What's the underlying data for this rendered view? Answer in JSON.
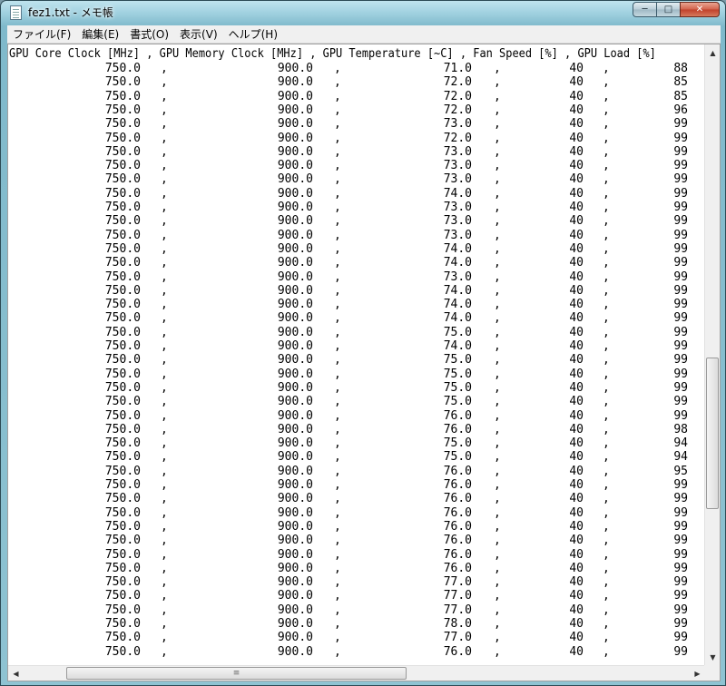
{
  "window": {
    "title": "fez1.txt - メモ帳"
  },
  "caption": {
    "minimize": "─",
    "maximize": "□",
    "close": "✕"
  },
  "menu": [
    "ファイル(F)",
    "編集(E)",
    "書式(O)",
    "表示(V)",
    "ヘルプ(H)"
  ],
  "header": "GPU Core Clock [MHz] , GPU Memory Clock [MHz] , GPU Temperature [~C] , Fan Speed [%] , GPU Load [%]",
  "rows": [
    [
      "750.0",
      "900.0",
      "71.0",
      "40",
      "88"
    ],
    [
      "750.0",
      "900.0",
      "72.0",
      "40",
      "85"
    ],
    [
      "750.0",
      "900.0",
      "72.0",
      "40",
      "85"
    ],
    [
      "750.0",
      "900.0",
      "72.0",
      "40",
      "96"
    ],
    [
      "750.0",
      "900.0",
      "73.0",
      "40",
      "99"
    ],
    [
      "750.0",
      "900.0",
      "72.0",
      "40",
      "99"
    ],
    [
      "750.0",
      "900.0",
      "73.0",
      "40",
      "99"
    ],
    [
      "750.0",
      "900.0",
      "73.0",
      "40",
      "99"
    ],
    [
      "750.0",
      "900.0",
      "73.0",
      "40",
      "99"
    ],
    [
      "750.0",
      "900.0",
      "74.0",
      "40",
      "99"
    ],
    [
      "750.0",
      "900.0",
      "73.0",
      "40",
      "99"
    ],
    [
      "750.0",
      "900.0",
      "73.0",
      "40",
      "99"
    ],
    [
      "750.0",
      "900.0",
      "73.0",
      "40",
      "99"
    ],
    [
      "750.0",
      "900.0",
      "74.0",
      "40",
      "99"
    ],
    [
      "750.0",
      "900.0",
      "74.0",
      "40",
      "99"
    ],
    [
      "750.0",
      "900.0",
      "73.0",
      "40",
      "99"
    ],
    [
      "750.0",
      "900.0",
      "74.0",
      "40",
      "99"
    ],
    [
      "750.0",
      "900.0",
      "74.0",
      "40",
      "99"
    ],
    [
      "750.0",
      "900.0",
      "74.0",
      "40",
      "99"
    ],
    [
      "750.0",
      "900.0",
      "75.0",
      "40",
      "99"
    ],
    [
      "750.0",
      "900.0",
      "74.0",
      "40",
      "99"
    ],
    [
      "750.0",
      "900.0",
      "75.0",
      "40",
      "99"
    ],
    [
      "750.0",
      "900.0",
      "75.0",
      "40",
      "99"
    ],
    [
      "750.0",
      "900.0",
      "75.0",
      "40",
      "99"
    ],
    [
      "750.0",
      "900.0",
      "75.0",
      "40",
      "99"
    ],
    [
      "750.0",
      "900.0",
      "76.0",
      "40",
      "99"
    ],
    [
      "750.0",
      "900.0",
      "76.0",
      "40",
      "98"
    ],
    [
      "750.0",
      "900.0",
      "75.0",
      "40",
      "94"
    ],
    [
      "750.0",
      "900.0",
      "75.0",
      "40",
      "94"
    ],
    [
      "750.0",
      "900.0",
      "76.0",
      "40",
      "95"
    ],
    [
      "750.0",
      "900.0",
      "76.0",
      "40",
      "99"
    ],
    [
      "750.0",
      "900.0",
      "76.0",
      "40",
      "99"
    ],
    [
      "750.0",
      "900.0",
      "76.0",
      "40",
      "99"
    ],
    [
      "750.0",
      "900.0",
      "76.0",
      "40",
      "99"
    ],
    [
      "750.0",
      "900.0",
      "76.0",
      "40",
      "99"
    ],
    [
      "750.0",
      "900.0",
      "76.0",
      "40",
      "99"
    ],
    [
      "750.0",
      "900.0",
      "76.0",
      "40",
      "99"
    ],
    [
      "750.0",
      "900.0",
      "77.0",
      "40",
      "99"
    ],
    [
      "750.0",
      "900.0",
      "77.0",
      "40",
      "99"
    ],
    [
      "750.0",
      "900.0",
      "77.0",
      "40",
      "99"
    ],
    [
      "750.0",
      "900.0",
      "78.0",
      "40",
      "99"
    ],
    [
      "750.0",
      "900.0",
      "77.0",
      "40",
      "99"
    ],
    [
      "750.0",
      "900.0",
      "76.0",
      "40",
      "99"
    ]
  ],
  "scrollbar": {
    "up": "▲",
    "down": "▼",
    "left": "◀",
    "right": "▶",
    "grip": "≡"
  }
}
